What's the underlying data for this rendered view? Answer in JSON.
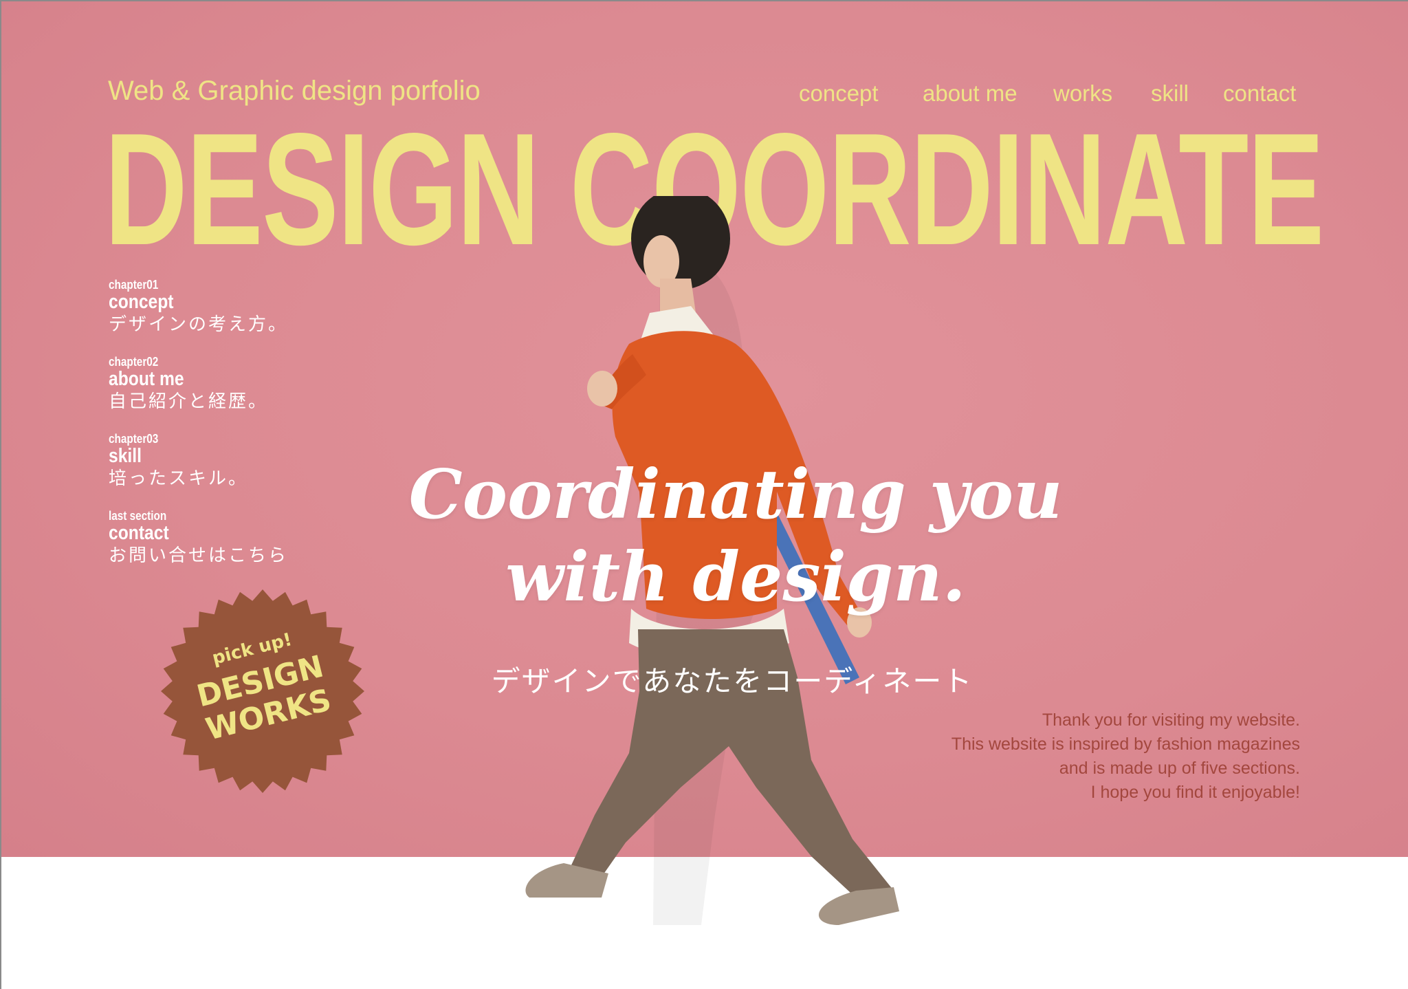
{
  "header": {
    "subtitle": "Web & Graphic design porfolio",
    "nav": [
      "concept",
      "about me",
      "works",
      "skill",
      "contact"
    ]
  },
  "hero": {
    "title": "DESIGN COORDINATE",
    "script_line1": "Coordinating you",
    "script_line2": "with design.",
    "jp_tagline": "デザインであなたをコーディネート"
  },
  "chapters": [
    {
      "num": "chapter01",
      "title": "concept",
      "desc": "デザインの考え方。"
    },
    {
      "num": "chapter02",
      "title": "about me",
      "desc": "自己紹介と経歴。"
    },
    {
      "num": "chapter03",
      "title": "skill",
      "desc": "培ったスキル。"
    },
    {
      "num": "last section",
      "title": "contact",
      "desc": "お問い合せはこちら"
    }
  ],
  "badge": {
    "line1": "pick up!",
    "line2": "DESIGN",
    "line3": "WORKS"
  },
  "intro": [
    "Thank you for visiting my website.",
    "This website is inspired by fashion magazines",
    "and is made up of five sections.",
    "I hope you find it enjoyable!"
  ],
  "colors": {
    "hero_bg": "#dc8a92",
    "accent_yellow": "#efe485",
    "badge_brown": "#96553a",
    "intro_text": "#a3473e"
  }
}
